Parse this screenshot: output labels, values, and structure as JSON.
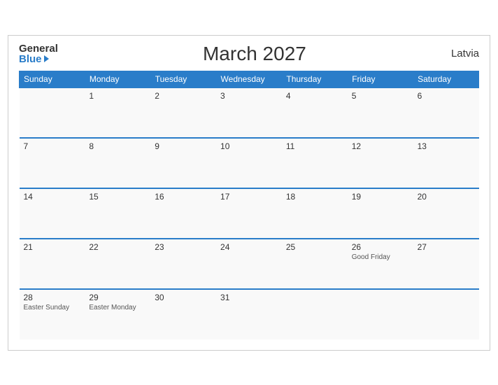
{
  "header": {
    "logo_general": "General",
    "logo_blue": "Blue",
    "title": "March 2027",
    "country": "Latvia"
  },
  "weekdays": [
    "Sunday",
    "Monday",
    "Tuesday",
    "Wednesday",
    "Thursday",
    "Friday",
    "Saturday"
  ],
  "weeks": [
    [
      {
        "day": "",
        "event": ""
      },
      {
        "day": "1",
        "event": ""
      },
      {
        "day": "2",
        "event": ""
      },
      {
        "day": "3",
        "event": ""
      },
      {
        "day": "4",
        "event": ""
      },
      {
        "day": "5",
        "event": ""
      },
      {
        "day": "6",
        "event": ""
      }
    ],
    [
      {
        "day": "7",
        "event": ""
      },
      {
        "day": "8",
        "event": ""
      },
      {
        "day": "9",
        "event": ""
      },
      {
        "day": "10",
        "event": ""
      },
      {
        "day": "11",
        "event": ""
      },
      {
        "day": "12",
        "event": ""
      },
      {
        "day": "13",
        "event": ""
      }
    ],
    [
      {
        "day": "14",
        "event": ""
      },
      {
        "day": "15",
        "event": ""
      },
      {
        "day": "16",
        "event": ""
      },
      {
        "day": "17",
        "event": ""
      },
      {
        "day": "18",
        "event": ""
      },
      {
        "day": "19",
        "event": ""
      },
      {
        "day": "20",
        "event": ""
      }
    ],
    [
      {
        "day": "21",
        "event": ""
      },
      {
        "day": "22",
        "event": ""
      },
      {
        "day": "23",
        "event": ""
      },
      {
        "day": "24",
        "event": ""
      },
      {
        "day": "25",
        "event": ""
      },
      {
        "day": "26",
        "event": "Good Friday"
      },
      {
        "day": "27",
        "event": ""
      }
    ],
    [
      {
        "day": "28",
        "event": "Easter Sunday"
      },
      {
        "day": "29",
        "event": "Easter Monday"
      },
      {
        "day": "30",
        "event": ""
      },
      {
        "day": "31",
        "event": ""
      },
      {
        "day": "",
        "event": ""
      },
      {
        "day": "",
        "event": ""
      },
      {
        "day": "",
        "event": ""
      }
    ]
  ]
}
